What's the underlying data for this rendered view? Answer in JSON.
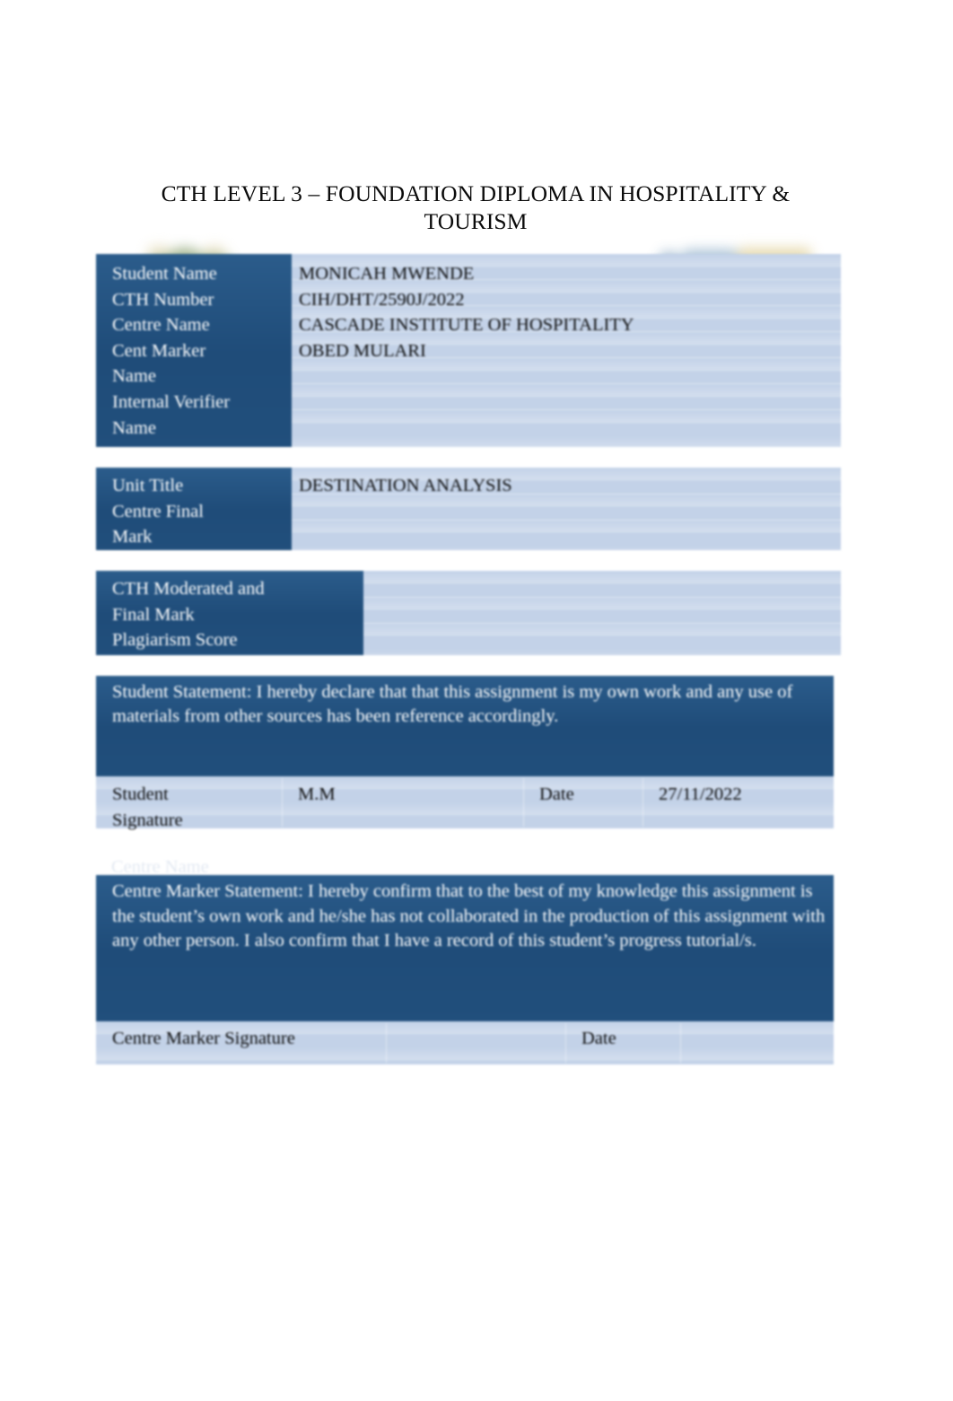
{
  "document": {
    "title": "CTH LEVEL 3 – FOUNDATION DIPLOMA IN HOSPITALITY & TOURISM",
    "ghost_text": "Centre Name"
  },
  "logos": {
    "left_name": "cascade-institute-logo",
    "right_name": "cth-logo"
  },
  "student_info": {
    "labels": "Student Name\nCTH Number\nCentre Name\nCent Marker\nName\nInternal Verifier\nName",
    "values": "MONICAH MWENDE\nCIH/DHT/2590J/2022\nCASCADE INSTITUTE OF HOSPITALITY\nOBED MULARI",
    "rows": [
      {
        "label": "Student Name",
        "value": "MONICAH MWENDE"
      },
      {
        "label": "CTH Number",
        "value": "CIH/DHT/2590J/2022"
      },
      {
        "label": "Centre Name",
        "value": "CASCADE INSTITUTE OF HOSPITALITY"
      },
      {
        "label": "Cent Marker Name",
        "value": "OBED MULARI"
      },
      {
        "label": "Internal Verifier Name",
        "value": ""
      }
    ]
  },
  "unit_info": {
    "labels": "Unit Title\nCentre Final\nMark",
    "values": "DESTINATION ANALYSIS",
    "rows": [
      {
        "label": "Unit Title",
        "value": "DESTINATION ANALYSIS"
      },
      {
        "label": "Centre Final Mark",
        "value": ""
      }
    ]
  },
  "moderation_info": {
    "labels": "CTH Moderated and\nFinal Mark\nPlagiarism Score",
    "rows": [
      {
        "label": "CTH Moderated and Final Mark",
        "value": ""
      },
      {
        "label": "Plagiarism Score",
        "value": ""
      }
    ]
  },
  "student_statement": {
    "heading": "Student Statement:",
    "body": "I hereby declare that that this assignment is my own work and any use of materials from other sources has been reference accordingly.",
    "full_text": "Student Statement:\nI hereby declare that that this assignment is my own work and any use of materials from other sources has been reference accordingly.",
    "signature_label": "Student\nSignature",
    "signature_value": "M.M",
    "date_label": "Date",
    "date_value": "27/11/2022"
  },
  "centre_marker_statement": {
    "heading": "Centre Marker Statement:",
    "body": "I hereby confirm that to the best of my knowledge this assignment is the student’s own work and he/she has not collaborated in the production of this assignment with any other person. I also confirm that I have a record of this student’s progress tutorial/s.",
    "full_text": "Centre Marker Statement:\nI hereby confirm that to the best of my knowledge this assignment is the student’s own work and he/she has not collaborated in the production of this assignment with any other person. I also confirm that I have a record of this student’s progress tutorial/s.",
    "signature_label": "Centre Marker Signature",
    "signature_value": "",
    "date_label": "Date",
    "date_value": ""
  },
  "colors": {
    "dark_blue": "#22517E",
    "light_blue": "#C3D2E8",
    "text_dark": "#0E0E0E",
    "text_light": "#FFFFFF",
    "logo_green": "#85A06A",
    "logo_gold": "#E6D9AD",
    "logo_steel": "#A8C0D4"
  }
}
